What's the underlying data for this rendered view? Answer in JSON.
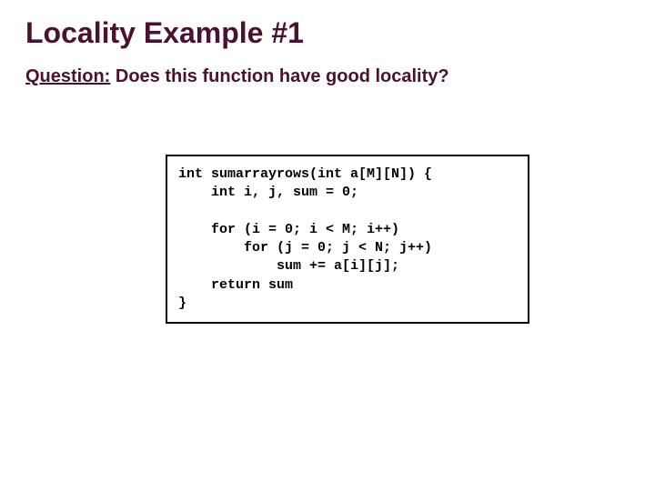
{
  "title": "Locality Example #1",
  "question_label": "Question:",
  "question_text": " Does this function have good locality?",
  "code": "int sumarrayrows(int a[M][N]) {\n    int i, j, sum = 0;\n\n    for (i = 0; i < M; i++)\n        for (j = 0; j < N; j++)\n            sum += a[i][j];\n    return sum\n}"
}
